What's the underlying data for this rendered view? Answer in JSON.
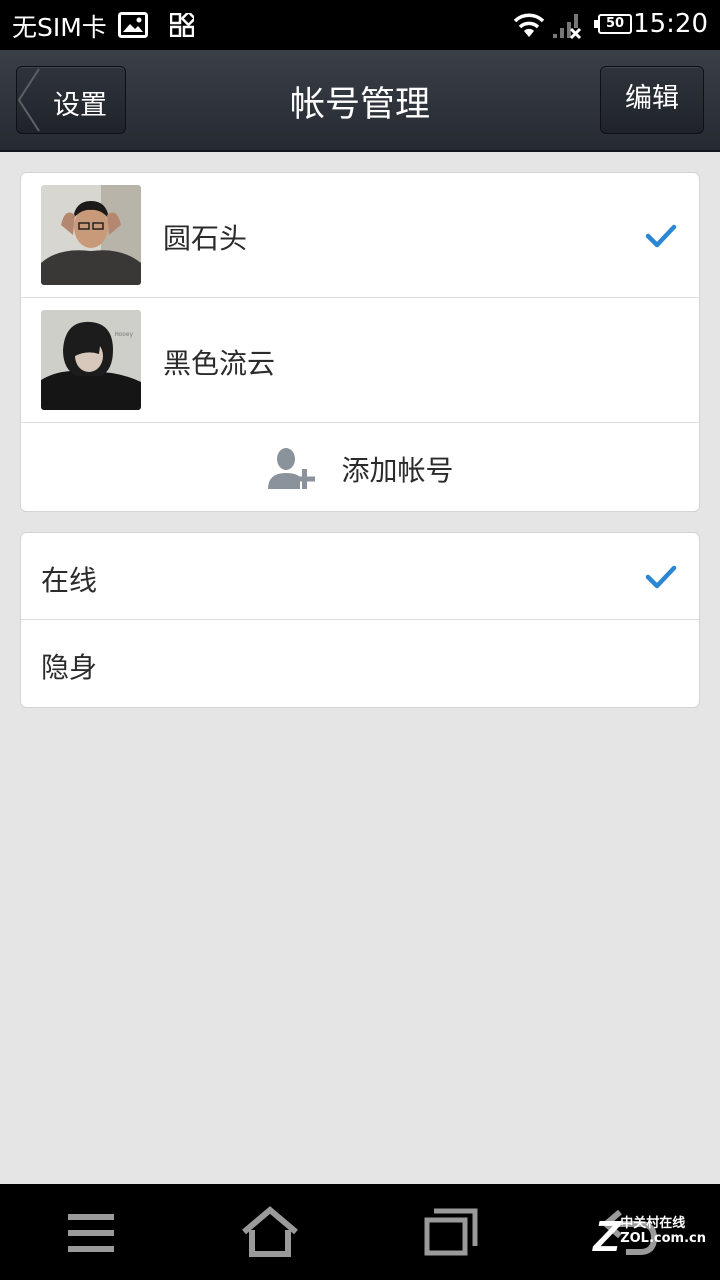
{
  "status_bar": {
    "carrier": "无SIM卡",
    "battery": "50",
    "time": "15:20"
  },
  "header": {
    "back_label": "设置",
    "title": "帐号管理",
    "edit_label": "编辑"
  },
  "accounts": [
    {
      "name": "圆石头",
      "selected": true
    },
    {
      "name": "黑色流云",
      "selected": false
    }
  ],
  "add_account_label": "添加帐号",
  "status_options": [
    {
      "label": "在线",
      "selected": true
    },
    {
      "label": "隐身",
      "selected": false
    }
  ],
  "watermark": {
    "logo": "Z",
    "line1": "中关村在线",
    "line2": "ZOL.com.cn"
  },
  "colors": {
    "accent_check": "#2b86d4",
    "header_bg": "#2d3239",
    "page_bg": "#e5e5e5"
  }
}
